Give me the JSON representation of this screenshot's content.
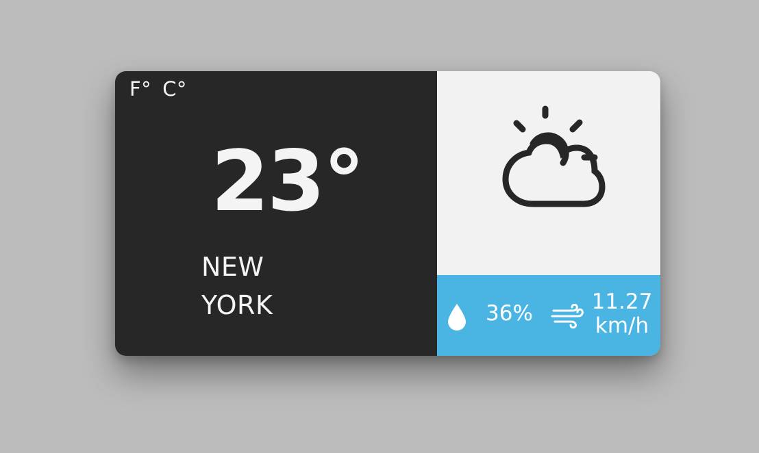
{
  "units": {
    "fahrenheit_label": "F°",
    "celsius_label": "C°"
  },
  "current": {
    "temperature": "23°",
    "city_line1": "NEW",
    "city_line2": "YORK"
  },
  "conditions": {
    "icon": "partly-cloudy-icon",
    "humidity": "36%",
    "humidity_icon": "water-drop-icon",
    "wind_value": "11.27",
    "wind_unit": "km/h",
    "wind_icon": "wind-icon"
  },
  "colors": {
    "dark_panel": "#272727",
    "light_panel": "#f2f2f2",
    "accent_blue": "#4ab5e3"
  }
}
